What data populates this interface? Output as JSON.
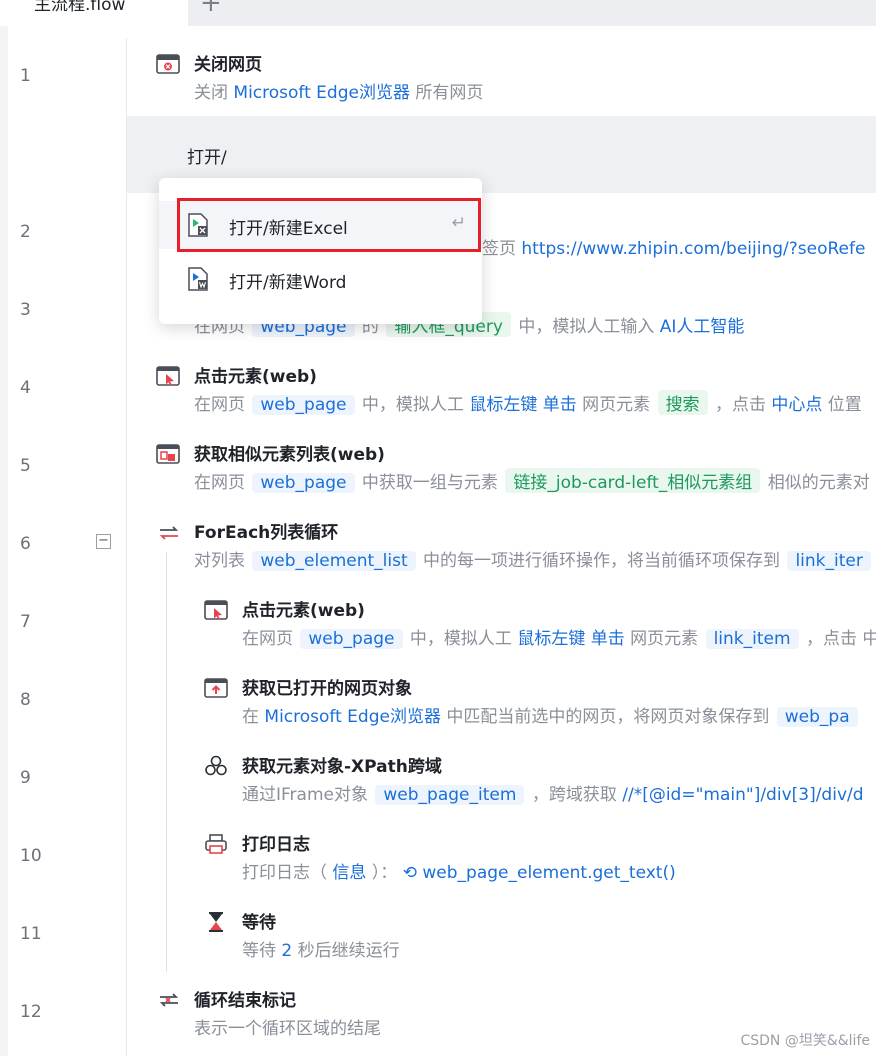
{
  "tab": {
    "title": "主流程.flow",
    "add": "+"
  },
  "line_numbers": [
    "1",
    "2",
    "3",
    "4",
    "5",
    "6",
    "7",
    "8",
    "9",
    "10",
    "11",
    "12"
  ],
  "collapse_symbol": "−",
  "typed_text": "打开/",
  "dropdown": {
    "items": [
      {
        "label": "打开/新建Excel",
        "icon": "excel-file-icon",
        "enter": "↵"
      },
      {
        "label": "打开/新建Word",
        "icon": "word-file-icon"
      }
    ]
  },
  "steps": {
    "s1": {
      "title": "关闭网页",
      "icon": "close-browser-icon",
      "d0": "关闭 ",
      "d1": "Microsoft Edge浏览器",
      "d2": " 所有网页"
    },
    "s2": {
      "d0": "签页 ",
      "d1": "https://www.zhipin.com/beijing/?seoRefe"
    },
    "s3": {
      "d0": "在网页 ",
      "c1": "web_page",
      "d1": " 的 ",
      "c2": "输入框_query",
      "d2": " 中，模拟人工输入 ",
      "d3": "AI人工智能"
    },
    "s4": {
      "title": "点击元素(web)",
      "icon": "click-element-icon",
      "d0": "在网页 ",
      "c1": "web_page",
      "d1": " 中，模拟人工 ",
      "d2": "鼠标左键 单击",
      "d3": " 网页元素 ",
      "c2": "搜索",
      "d4": " ，点击 ",
      "d5": "中心点",
      "d6": " 位置"
    },
    "s5": {
      "title": "获取相似元素列表(web)",
      "icon": "similar-elements-icon",
      "d0": "在网页 ",
      "c1": "web_page",
      "d1": " 中获取一组与元素 ",
      "c2": "链接_job-card-left_相似元素组",
      "d2": " 相似的元素对"
    },
    "s6": {
      "title": "ForEach列表循环",
      "icon": "loop-icon",
      "d0": "对列表 ",
      "c1": "web_element_list",
      "d1": " 中的每一项进行循环操作，将当前循环项保存到 ",
      "c2": "link_iter"
    },
    "s7": {
      "title": "点击元素(web)",
      "icon": "click-element-icon",
      "d0": "在网页 ",
      "c1": "web_page",
      "d1": " 中，模拟人工 ",
      "d2": "鼠标左键 单击",
      "d3": " 网页元素 ",
      "c2": "link_item",
      "d4": " ，点击 中"
    },
    "s8": {
      "title": "获取已打开的网页对象",
      "icon": "browser-upload-icon",
      "d0": "在 ",
      "d1": "Microsoft Edge浏览器",
      "d2": " 中匹配当前选中的网页，将网页对象保存到 ",
      "c1": "web_pa"
    },
    "s9": {
      "title": "获取元素对象-XPath跨域",
      "icon": "cubes-icon",
      "d0": "通过IFrame对象 ",
      "c1": "web_page_item",
      "d1": " ，跨域获取 ",
      "d2": "//*[@id=\"main\"]/div[3]/div/d"
    },
    "s10": {
      "title": "打印日志",
      "icon": "printer-icon",
      "d0": "打印日志（ ",
      "d1": "信息",
      "d2": " ）： ",
      "d3": "web_page_element.get_text()"
    },
    "s11": {
      "title": "等待",
      "icon": "hourglass-icon",
      "d0": "等待 ",
      "d1": "2",
      "d2": " 秒后继续运行"
    },
    "s12": {
      "title": "循环结束标记",
      "icon": "loop-end-icon",
      "d0": "表示一个循环区域的结尾"
    }
  },
  "watermark": "CSDN @坦笑&&life",
  "colors": {
    "accent": "#1a6fd8",
    "highlight": "#e5202a",
    "chip_green": "#1d9a5b"
  }
}
